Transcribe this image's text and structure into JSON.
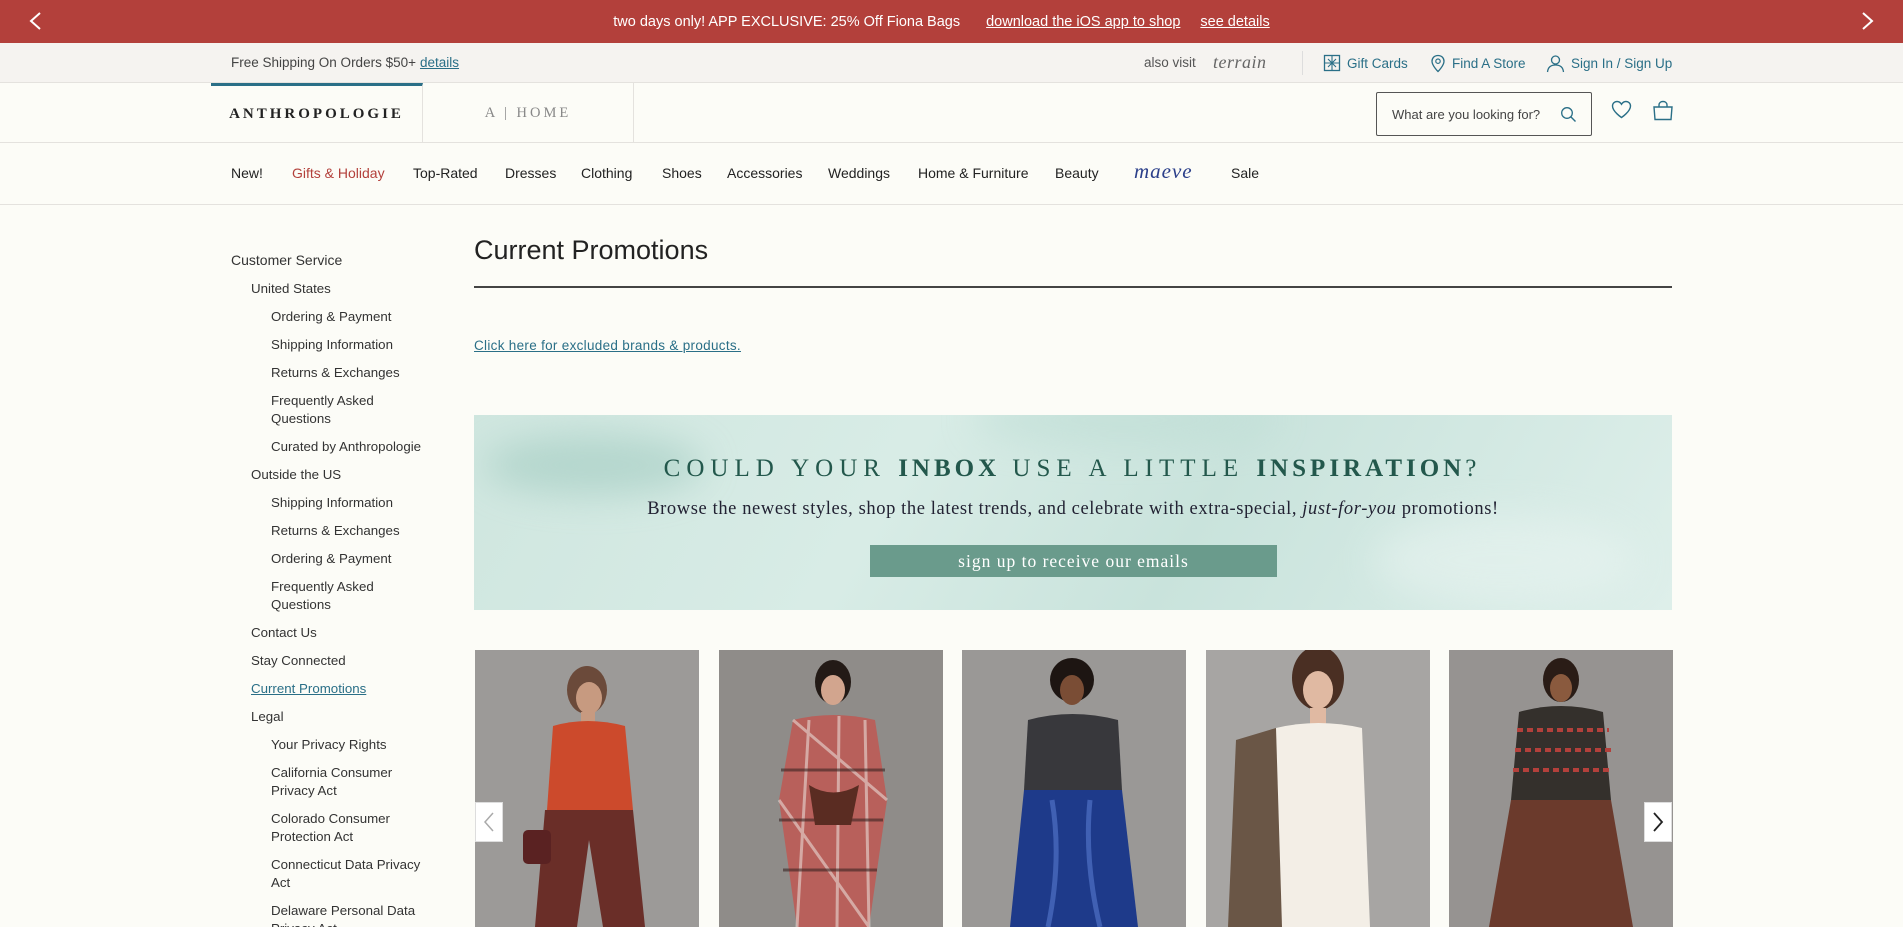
{
  "promo": {
    "message": "two days only! APP EXCLUSIVE: 25% Off Fiona Bags",
    "app_link": "download the iOS app to shop",
    "details_link": "see details"
  },
  "utility": {
    "shipping_text": "Free Shipping On Orders $50+",
    "shipping_details": "details",
    "also_visit": "also visit",
    "terrain": "terrain",
    "gift_cards": "Gift Cards",
    "find_store": "Find A Store",
    "sign_in": "Sign In / Sign Up"
  },
  "header": {
    "brand_tab": "ANTHROPOLOGIE",
    "home_tab": "A | HOME",
    "search_placeholder": "What are you looking for?"
  },
  "nav": {
    "items": [
      "New!",
      "Gifts & Holiday",
      "Top-Rated",
      "Dresses",
      "Clothing",
      "Shoes",
      "Accessories",
      "Weddings",
      "Home & Furniture",
      "Beauty",
      "maeve",
      "Sale"
    ]
  },
  "sidebar": {
    "customer_service": "Customer Service",
    "united_states": "United States",
    "us_items": [
      "Ordering & Payment",
      "Shipping Information",
      "Returns & Exchanges",
      "Frequently Asked\nQuestions",
      "Curated by Anthropologie"
    ],
    "outside_us": "Outside the US",
    "outside_items": [
      "Shipping Information",
      "Returns & Exchanges",
      "Ordering & Payment",
      "Frequently Asked\nQuestions"
    ],
    "contact_us": "Contact Us",
    "stay_connected": "Stay Connected",
    "current_promotions": "Current Promotions",
    "legal": "Legal",
    "legal_items": [
      "Your Privacy Rights",
      "California Consumer\nPrivacy Act",
      "Colorado Consumer\nProtection Act",
      "Connecticut Data Privacy\nAct",
      "Delaware Personal Data\nPrivacy Act"
    ]
  },
  "main": {
    "title": "Current Promotions",
    "excluded_link": "Click here for excluded brands & products."
  },
  "email_signup": {
    "head_a": "COULD YOUR ",
    "head_b": "INBOX",
    "head_c": " USE A LITTLE ",
    "head_d": "INSPIRATION",
    "head_e": "?",
    "sub_a": "Browse the newest styles, shop the latest trends, and celebrate with extra-special, ",
    "sub_b": "just-for-you",
    "sub_c": " promotions!",
    "button": "sign up to receive our emails"
  },
  "colors": {
    "promo_bg": "#b3403b",
    "accent_teal": "#2a6f87",
    "gifts_red": "#b3403b",
    "signup_button": "#6a9b8c"
  },
  "carousel": {
    "products": [
      "red-cardigan-look",
      "plaid-shirt-dress-look",
      "blue-satin-skirt-look",
      "white-drop-waist-dress-look",
      "fair-isle-sweater-look"
    ]
  }
}
